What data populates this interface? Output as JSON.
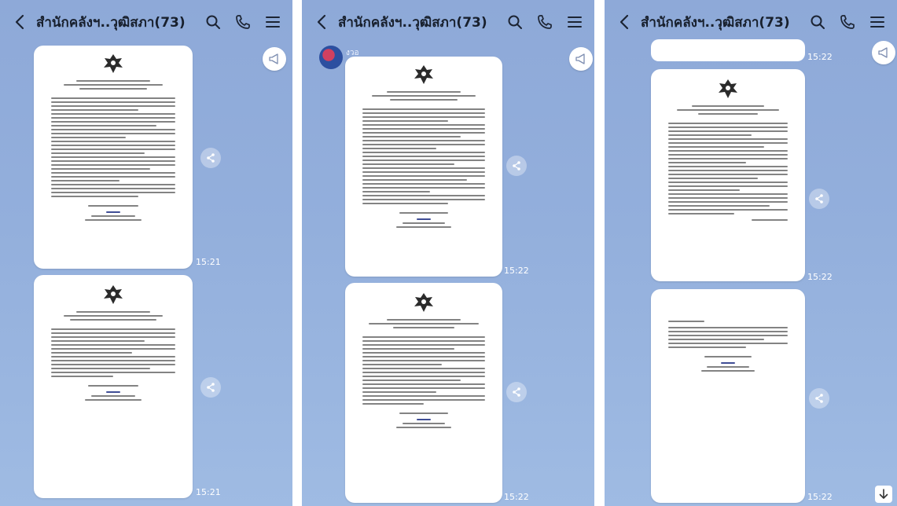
{
  "chat": {
    "title": "สำนักคลังฯ..วุฒิสภา(73)"
  },
  "panel2": {
    "sender": "งวอ"
  },
  "times": {
    "p1_first": "15:21",
    "p1_second": "15:21",
    "p2_first": "15:22",
    "p2_second": "15:22",
    "p3_top": "15:22",
    "p3_middle": "15:22",
    "p3_bottom": "15:22"
  },
  "icons": {
    "back": "chevron-left-icon",
    "search": "search-icon",
    "call": "phone-icon",
    "menu": "menu-icon",
    "announce": "megaphone-icon",
    "share": "share-icon",
    "scroll": "arrow-down-icon"
  },
  "colors": {
    "background": "#93afdc",
    "bubble": "#ffffff",
    "header_text": "#18202d"
  }
}
